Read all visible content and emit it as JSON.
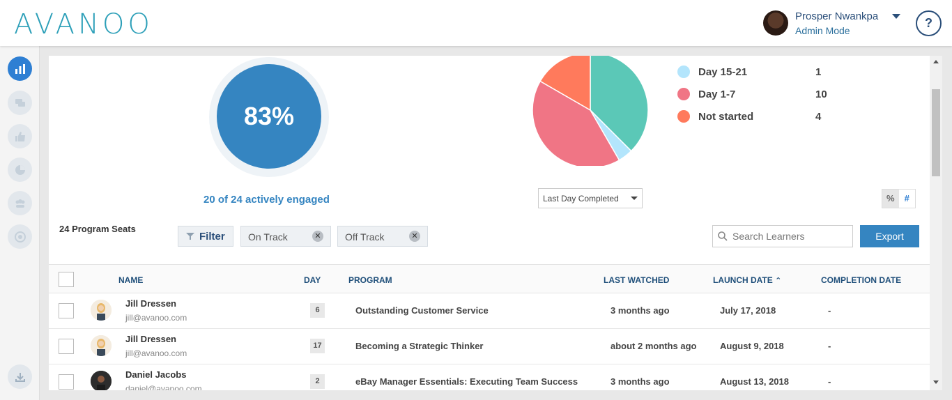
{
  "brand": {
    "logo": "AVANOO"
  },
  "user": {
    "name": "Prosper Nwankpa",
    "mode": "Admin Mode"
  },
  "help": {
    "label": "?"
  },
  "sidebar": {
    "icons": [
      "bar-chart-icon",
      "chat-icon",
      "thumbs-up-icon",
      "pie-chart-icon",
      "people-icon",
      "target-icon",
      "download-icon"
    ]
  },
  "engagement": {
    "percent": "83%",
    "caption": "20 of 24 actively engaged"
  },
  "chart_data": {
    "type": "pie",
    "slices": [
      {
        "label": "Day 15-21",
        "value": 1,
        "color": "#b3e5fc"
      },
      {
        "label": "Day 1-7",
        "value": 10,
        "color": "#f07585"
      },
      {
        "label": "Not started",
        "value": 4,
        "color": "#ff7a5c"
      },
      {
        "label": "",
        "value": 9,
        "color": "#5bc8b7"
      }
    ]
  },
  "legend": [
    {
      "label": "Day 15-21",
      "value": "1",
      "color": "#b3e5fc"
    },
    {
      "label": "Day 1-7",
      "value": "10",
      "color": "#f07585"
    },
    {
      "label": "Not started",
      "value": "4",
      "color": "#ff7a5c"
    }
  ],
  "chart_controls": {
    "select_value": "Last Day Completed",
    "toggle_pct": "%",
    "toggle_hash": "#"
  },
  "filters": {
    "seats": "24 Program Seats",
    "filter_label": "Filter",
    "chips": [
      "On Track",
      "Off Track"
    ],
    "search_placeholder": "Search Learners",
    "export_label": "Export"
  },
  "table": {
    "columns": {
      "name": "NAME",
      "day": "DAY",
      "program": "PROGRAM",
      "last_watched": "LAST WATCHED",
      "launch_date": "LAUNCH DATE",
      "completion_date": "COMPLETION DATE"
    },
    "rows": [
      {
        "name": "Jill Dressen",
        "email": "jill@avanoo.com",
        "day": "6",
        "program": "Outstanding Customer Service",
        "last_watched": "3 months ago",
        "launch_date": "July 17, 2018",
        "completion_date": "-"
      },
      {
        "name": "Jill Dressen",
        "email": "jill@avanoo.com",
        "day": "17",
        "program": "Becoming a Strategic Thinker",
        "last_watched": "about 2 months ago",
        "launch_date": "August 9, 2018",
        "completion_date": "-"
      },
      {
        "name": "Daniel Jacobs",
        "email": "daniel@avanoo.com",
        "day": "2",
        "program": "eBay Manager Essentials: Executing Team Success",
        "last_watched": "3 months ago",
        "launch_date": "August 13, 2018",
        "completion_date": "-"
      }
    ]
  }
}
